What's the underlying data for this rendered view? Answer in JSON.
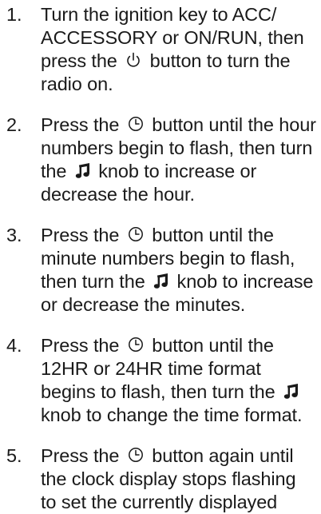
{
  "steps": [
    {
      "number": "1.",
      "parts": [
        "Turn the ignition key to ACC/ ACCESSORY or ON/RUN, then press the",
        "button to turn the radio on."
      ],
      "icons": [
        "power-icon"
      ]
    },
    {
      "number": "2.",
      "parts": [
        "Press the",
        "button until the hour numbers begin to flash, then turn the",
        "knob to increase or decrease the hour."
      ],
      "icons": [
        "clock-icon",
        "music-note-icon"
      ]
    },
    {
      "number": "3.",
      "parts": [
        "Press the",
        "button until the minute numbers begin to flash, then turn the",
        "knob to increase or decrease the minutes."
      ],
      "icons": [
        "clock-icon",
        "music-note-icon"
      ]
    },
    {
      "number": "4.",
      "parts": [
        "Press the",
        "button until the 12HR or 24HR time format begins to flash, then turn the",
        "knob to change the time format."
      ],
      "icons": [
        "clock-icon",
        "music-note-icon"
      ]
    },
    {
      "number": "5.",
      "parts": [
        "Press the",
        "button again until the clock display stops flashing to set the currently displayed"
      ],
      "icons": [
        "clock-icon"
      ]
    }
  ]
}
